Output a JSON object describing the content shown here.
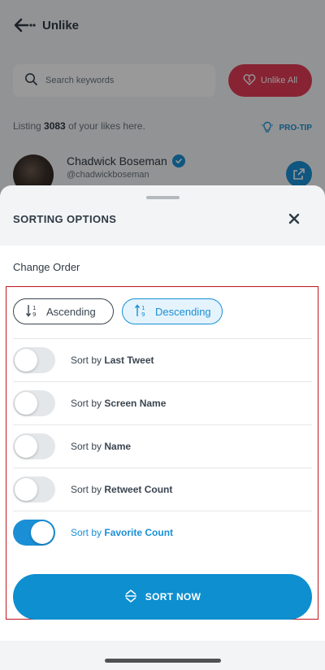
{
  "background": {
    "title": "Unlike",
    "search": {
      "placeholder": "Search keywords"
    },
    "unlike_all": "Unlike All",
    "listing": {
      "prefix": "Listing ",
      "count": "3083",
      "suffix": " of your likes here."
    },
    "protip": "PRO-TIP",
    "user": {
      "name": "Chadwick Boseman",
      "handle": "@chadwickboseman"
    }
  },
  "sheet": {
    "title": "SORTING OPTIONS",
    "change_order": "Change Order",
    "order_options": [
      {
        "label": "Ascending",
        "selected": false
      },
      {
        "label": "Descending",
        "selected": true
      }
    ],
    "sort_prefix": "Sort by ",
    "sort_options": [
      {
        "key": "Last Tweet",
        "enabled": false
      },
      {
        "key": "Screen Name",
        "enabled": false
      },
      {
        "key": "Name",
        "enabled": false
      },
      {
        "key": "Retweet Count",
        "enabled": false
      },
      {
        "key": "Favorite Count",
        "enabled": true
      }
    ],
    "sort_now": "SORT NOW"
  },
  "colors": {
    "accent": "#1a8fd6",
    "button": "#0d8fd0",
    "danger": "#e23b56",
    "highlight_border": "#c0141c"
  },
  "icons": [
    "back-arrow-icon",
    "search-icon",
    "heart-broken-icon",
    "lightbulb-icon",
    "verified-icon",
    "external-link-icon",
    "close-icon",
    "sort-ascending-icon",
    "sort-descending-icon",
    "sort-arrows-icon"
  ]
}
